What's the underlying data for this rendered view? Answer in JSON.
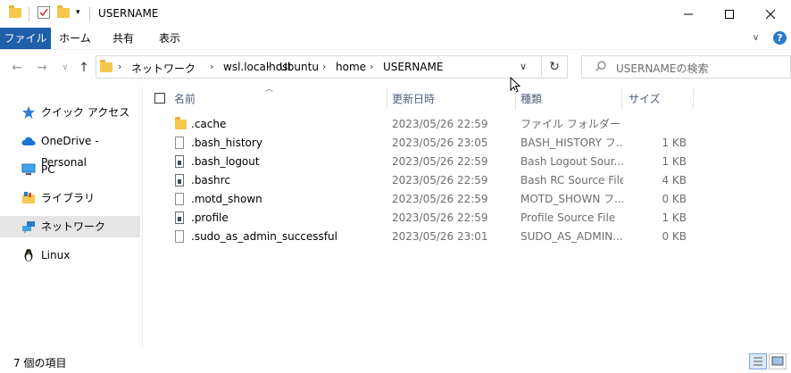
{
  "window": {
    "title": "USERNAME"
  },
  "ribbon": {
    "tabs": [
      "ファイル",
      "ホーム",
      "共有",
      "表示"
    ]
  },
  "address": {
    "crumbs": [
      "ネットワーク",
      "wsl.localhost",
      "Ubuntu",
      "home",
      "USERNAME"
    ]
  },
  "search": {
    "placeholder": "USERNAMEの検索"
  },
  "sidebar": {
    "items": [
      {
        "label": "クイック アクセス",
        "icon": "star-icon"
      },
      {
        "label": "OneDrive - Personal",
        "icon": "cloud-icon"
      },
      {
        "label": "PC",
        "icon": "computer-icon"
      },
      {
        "label": "ライブラリ",
        "icon": "library-icon"
      },
      {
        "label": "ネットワーク",
        "icon": "network-icon",
        "active": true
      },
      {
        "label": "Linux",
        "icon": "penguin-icon"
      }
    ]
  },
  "columns": {
    "name": "名前",
    "date": "更新日時",
    "type": "種類",
    "size": "サイズ"
  },
  "files": [
    {
      "name": ".cache",
      "date": "2023/05/26 22:59",
      "type": "ファイル フォルダー",
      "size": "",
      "icon": "folder-icon"
    },
    {
      "name": ".bash_history",
      "date": "2023/05/26 23:05",
      "type": "BASH_HISTORY フ...",
      "size": "1 KB",
      "icon": "file-icon"
    },
    {
      "name": ".bash_logout",
      "date": "2023/05/26 22:59",
      "type": "Bash Logout Sour...",
      "size": "1 KB",
      "icon": "script-file-icon"
    },
    {
      "name": ".bashrc",
      "date": "2023/05/26 22:59",
      "type": "Bash RC Source File",
      "size": "4 KB",
      "icon": "script-file-icon"
    },
    {
      "name": ".motd_shown",
      "date": "2023/05/26 22:59",
      "type": "MOTD_SHOWN フ...",
      "size": "0 KB",
      "icon": "file-icon"
    },
    {
      "name": ".profile",
      "date": "2023/05/26 22:59",
      "type": "Profile Source File",
      "size": "1 KB",
      "icon": "script-file-icon"
    },
    {
      "name": ".sudo_as_admin_successful",
      "date": "2023/05/26 23:01",
      "type": "SUDO_AS_ADMIN...",
      "size": "0 KB",
      "icon": "file-icon"
    }
  ],
  "status": {
    "text": "7 個の項目"
  }
}
